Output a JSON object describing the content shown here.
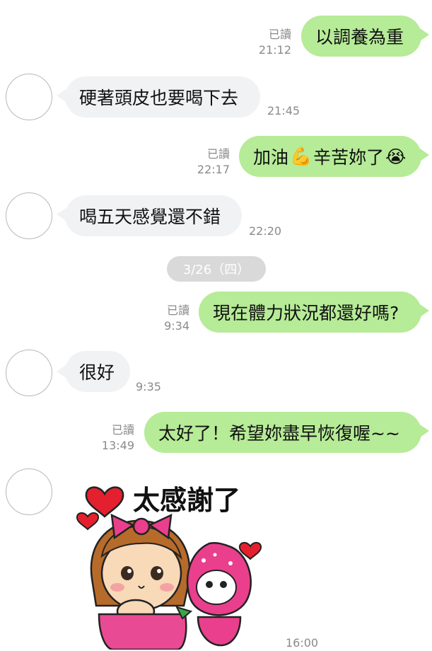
{
  "chat": {
    "date_divider": "3/26（四）",
    "messages": [
      {
        "side": "out",
        "text": "以調養為重",
        "read": "已讀",
        "time": "21:12"
      },
      {
        "side": "in",
        "text": "硬著頭皮也要喝下去",
        "time": "21:45"
      },
      {
        "side": "out",
        "text_a": "加油",
        "text_b": "辛苦妳了",
        "emoji_a": "💪",
        "emoji_b": "😭",
        "read": "已讀",
        "time": "22:17"
      },
      {
        "side": "in",
        "text": "喝五天感覺還不錯",
        "time": "22:20"
      },
      {
        "side": "out",
        "text": "現在體力狀況都還好嗎?",
        "read": "已讀",
        "time": "9:34"
      },
      {
        "side": "in",
        "text": "很好",
        "time": "9:35"
      },
      {
        "side": "out",
        "text": "太好了！希望妳盡早恢復喔~~",
        "read": "已讀",
        "time": "13:49"
      },
      {
        "side": "in",
        "sticker": true,
        "sticker_text": "太感謝了",
        "time": "16:00"
      }
    ]
  },
  "colors": {
    "outgoing": "#b6eb97",
    "incoming": "#f1f2f4",
    "meta": "#8a8a8a"
  }
}
